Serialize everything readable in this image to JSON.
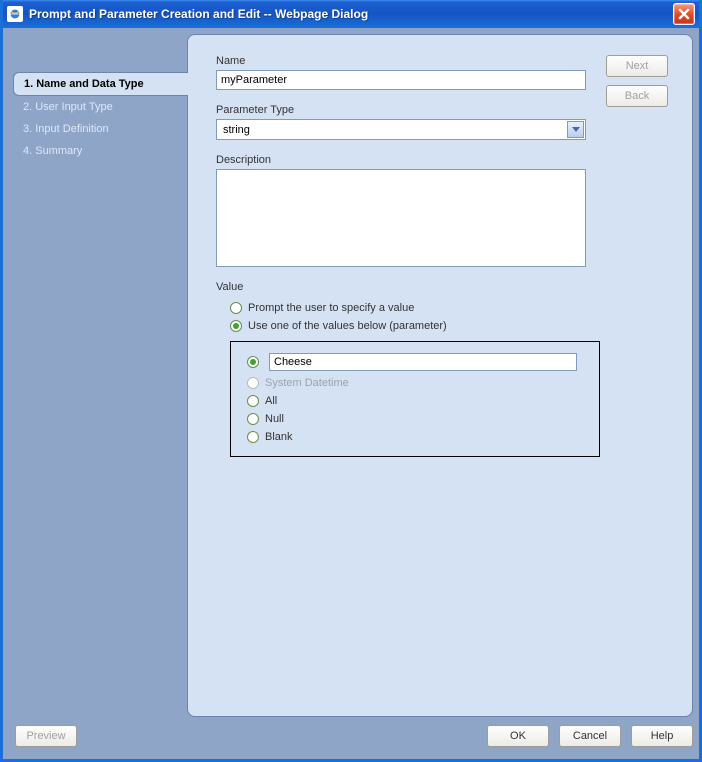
{
  "window": {
    "title": "Prompt and Parameter Creation and Edit -- Webpage Dialog"
  },
  "nav": {
    "steps": [
      {
        "label": "1. Name and Data Type",
        "active": true
      },
      {
        "label": "2. User Input Type",
        "active": false
      },
      {
        "label": "3. Input Definition",
        "active": false
      },
      {
        "label": "4. Summary",
        "active": false
      }
    ]
  },
  "form": {
    "name_label": "Name",
    "name_value": "myParameter",
    "type_label": "Parameter Type",
    "type_value": "string",
    "desc_label": "Description",
    "desc_value": "",
    "value_label": "Value",
    "value_radios": {
      "prompt": {
        "label": "Prompt the user to specify a value",
        "selected": false
      },
      "usebelow": {
        "label": "Use one of the values below (parameter)",
        "selected": true
      }
    },
    "value_options": [
      {
        "kind": "text",
        "value": "Cheese",
        "selected": true,
        "disabled": false
      },
      {
        "kind": "label",
        "label": "System Datetime",
        "selected": false,
        "disabled": true
      },
      {
        "kind": "label",
        "label": "All",
        "selected": false,
        "disabled": false
      },
      {
        "kind": "label",
        "label": "Null",
        "selected": false,
        "disabled": false
      },
      {
        "kind": "label",
        "label": "Blank",
        "selected": false,
        "disabled": false
      }
    ]
  },
  "buttons": {
    "next": "Next",
    "back": "Back",
    "preview": "Preview",
    "ok": "OK",
    "cancel": "Cancel",
    "help": "Help"
  }
}
